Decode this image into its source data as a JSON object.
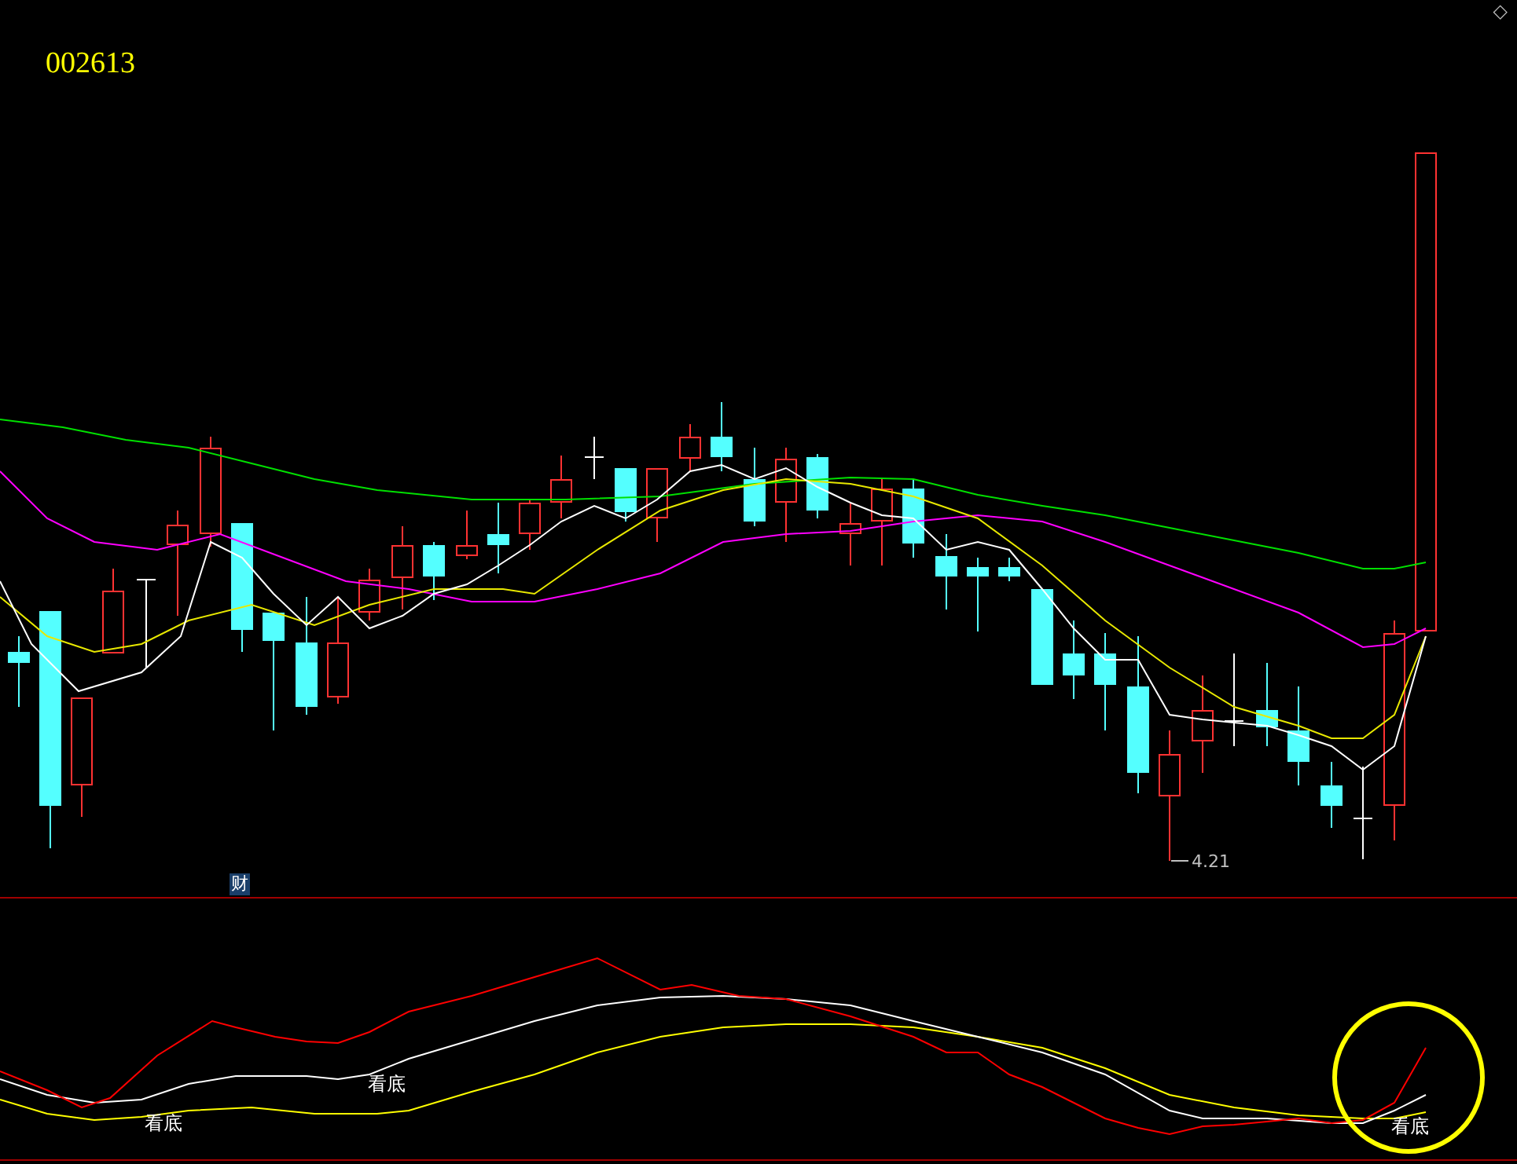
{
  "stock_code": "002613",
  "corner_symbol": "◇",
  "low_price_label": "4.21",
  "finance_badge": "财",
  "signals": [
    {
      "label": "看底"
    },
    {
      "label": "看底"
    },
    {
      "label": "看底"
    }
  ]
}
